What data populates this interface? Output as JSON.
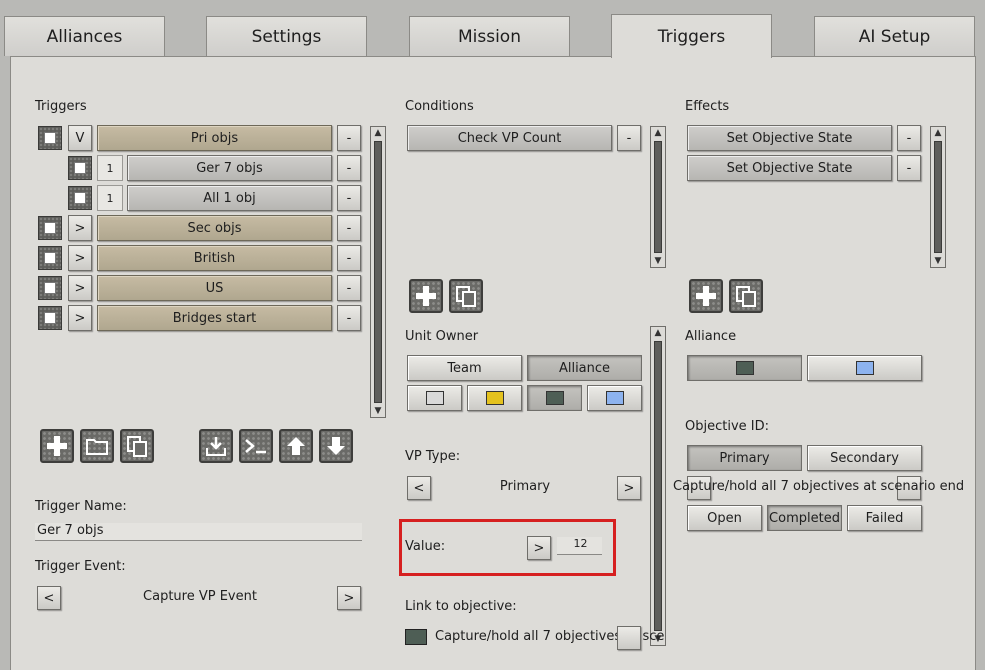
{
  "tabs": [
    "Alliances",
    "Settings",
    "Mission",
    "Triggers",
    "AI Setup"
  ],
  "triggers": {
    "heading": "Triggers",
    "rows": [
      {
        "toggle": "V",
        "label": "Pri objs",
        "remove": "-"
      },
      {
        "count": "1",
        "label": "Ger 7 objs",
        "remove": "-"
      },
      {
        "count": "1",
        "label": "All 1 obj",
        "remove": "-"
      },
      {
        "toggle": ">",
        "label": "Sec objs",
        "remove": "-"
      },
      {
        "toggle": ">",
        "label": "British",
        "remove": "-"
      },
      {
        "toggle": ">",
        "label": "US",
        "remove": "-"
      },
      {
        "toggle": ">",
        "label": "Bridges start",
        "remove": "-"
      }
    ],
    "name_label": "Trigger Name:",
    "name_value": "Ger 7 objs",
    "event_label": "Trigger Event:",
    "event_value": "Capture VP Event",
    "prev": "<",
    "next": ">"
  },
  "conditions": {
    "heading": "Conditions",
    "items": [
      {
        "label": "Check VP Count",
        "remove": "-"
      }
    ],
    "unit_owner_label": "Unit Owner",
    "owner_tabs": [
      "Team",
      "Alliance"
    ],
    "colors": [
      "#d9d9d9",
      "#e4c21e",
      "#4e5e55",
      "#8db3ef"
    ],
    "vp_type_label": "VP Type:",
    "vp_type_value": "Primary",
    "prev": "<",
    "next": ">",
    "value_label": "Value:",
    "value_step": ">",
    "value": "12",
    "link_label": "Link to objective:",
    "link_value": "Capture/hold all 7 objectives at sce",
    "link_color": "#4e5e55"
  },
  "effects": {
    "heading": "Effects",
    "items": [
      {
        "label": "Set Objective State",
        "remove": "-"
      },
      {
        "label": "Set Objective State",
        "remove": "-"
      }
    ],
    "alliance_label": "Alliance",
    "alliance_colors": [
      "#4e5e55",
      "#8db3ef"
    ],
    "objective_id_label": "Objective ID:",
    "objective_tabs": [
      "Primary",
      "Secondary"
    ],
    "objective_text": "Capture/hold all 7 objectives at scenario end",
    "states": [
      "Open",
      "Completed",
      "Failed"
    ]
  },
  "accent": "#d62020"
}
